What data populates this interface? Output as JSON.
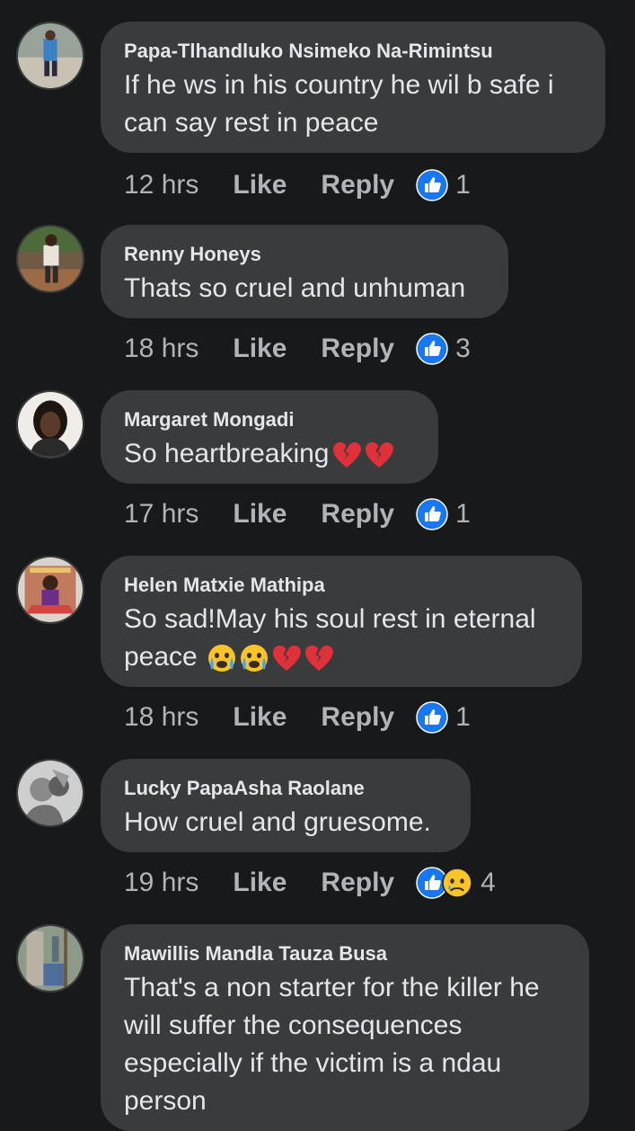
{
  "comments": [
    {
      "author": "Papa-Tlhandluko Nsimeko Na-Rimintsu",
      "text": "If he ws in his country he wil b safe i can say rest in peace",
      "emojis": [],
      "time": "12 hrs",
      "like_label": "Like",
      "reply_label": "Reply",
      "reactions": [
        "like"
      ],
      "reaction_count": "1"
    },
    {
      "author": "Renny Honeys",
      "text": "Thats so cruel and unhuman",
      "emojis": [],
      "time": "18 hrs",
      "like_label": "Like",
      "reply_label": "Reply",
      "reactions": [
        "like"
      ],
      "reaction_count": "3"
    },
    {
      "author": "Margaret Mongadi",
      "text": "So heartbreaking",
      "emojis": [
        "broken-heart",
        "broken-heart"
      ],
      "time": "17 hrs",
      "like_label": "Like",
      "reply_label": "Reply",
      "reactions": [
        "like"
      ],
      "reaction_count": "1"
    },
    {
      "author": "Helen Matxie Mathipa",
      "text": "So sad!May his soul rest in eternal peace",
      "emojis": [
        "crying-face",
        "crying-face",
        "broken-heart",
        "broken-heart"
      ],
      "time": "18 hrs",
      "like_label": "Like",
      "reply_label": "Reply",
      "reactions": [
        "like"
      ],
      "reaction_count": "1"
    },
    {
      "author": "Lucky PapaAsha Raolane",
      "text": "How cruel and gruesome.",
      "emojis": [],
      "time": "19 hrs",
      "like_label": "Like",
      "reply_label": "Reply",
      "reactions": [
        "like",
        "sad"
      ],
      "reaction_count": "4"
    },
    {
      "author": "Mawillis Mandla Tauza Busa",
      "text": "That's a non starter for the killer he will suffer the consequences especially if the victim is a ndau person",
      "emojis": [],
      "time": "",
      "like_label": "",
      "reply_label": "",
      "reactions": [],
      "reaction_count": ""
    }
  ],
  "colors": {
    "background": "#18191a",
    "bubble": "#3a3b3c",
    "text": "#e4e6eb",
    "meta": "#b0b3b8",
    "like_blue": "#1877f2"
  }
}
